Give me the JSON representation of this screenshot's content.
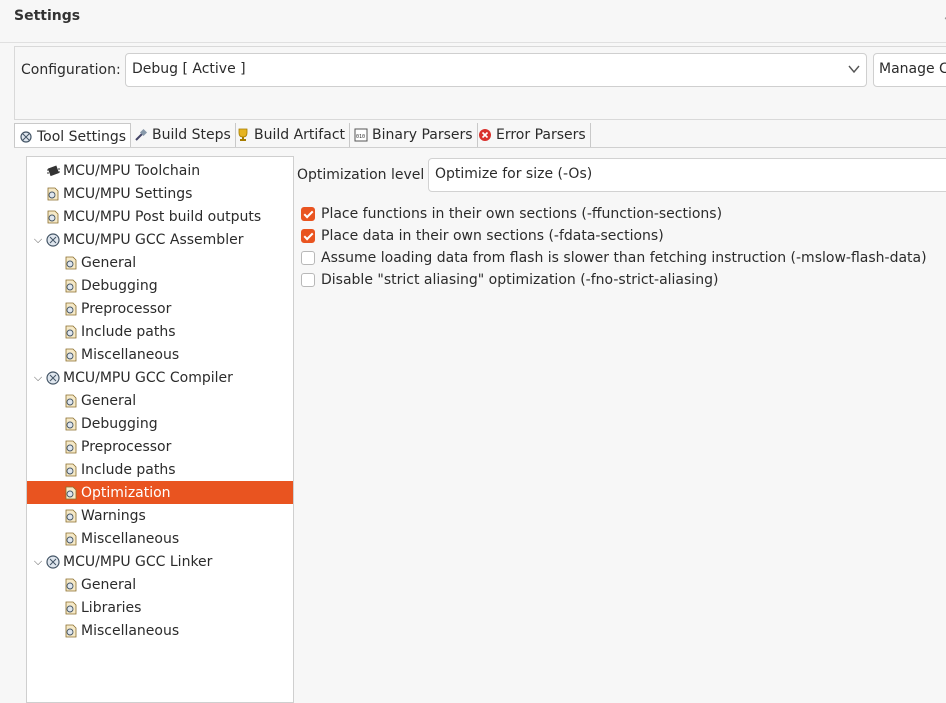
{
  "window": {
    "title": "Settings"
  },
  "config": {
    "label": "Configuration:",
    "value": "Debug  [ Active ]",
    "manage_label": "Manage Configurations..."
  },
  "tabs": [
    {
      "label": "Tool Settings",
      "icon": "tool-settings-icon",
      "active": true
    },
    {
      "label": "Build Steps",
      "icon": "build-steps-icon"
    },
    {
      "label": "Build Artifact",
      "icon": "trophy-icon"
    },
    {
      "label": "Binary Parsers",
      "icon": "binary-icon"
    },
    {
      "label": "Error Parsers",
      "icon": "error-icon"
    }
  ],
  "tree": [
    {
      "label": "MCU/MPU Toolchain",
      "level": 0
    },
    {
      "label": "MCU/MPU Settings",
      "level": 0
    },
    {
      "label": "MCU/MPU Post build outputs",
      "level": 0
    },
    {
      "label": "MCU/MPU GCC Assembler",
      "level": 0,
      "expanded": true
    },
    {
      "label": "General",
      "level": 1
    },
    {
      "label": "Debugging",
      "level": 1
    },
    {
      "label": "Preprocessor",
      "level": 1
    },
    {
      "label": "Include paths",
      "level": 1
    },
    {
      "label": "Miscellaneous",
      "level": 1
    },
    {
      "label": "MCU/MPU GCC Compiler",
      "level": 0,
      "expanded": true
    },
    {
      "label": "General",
      "level": 1
    },
    {
      "label": "Debugging",
      "level": 1
    },
    {
      "label": "Preprocessor",
      "level": 1
    },
    {
      "label": "Include paths",
      "level": 1
    },
    {
      "label": "Optimization",
      "level": 1,
      "selected": true
    },
    {
      "label": "Warnings",
      "level": 1
    },
    {
      "label": "Miscellaneous",
      "level": 1
    },
    {
      "label": "MCU/MPU GCC Linker",
      "level": 0,
      "expanded": true
    },
    {
      "label": "General",
      "level": 1
    },
    {
      "label": "Libraries",
      "level": 1
    },
    {
      "label": "Miscellaneous",
      "level": 1
    }
  ],
  "optimization": {
    "level_label": "Optimization level",
    "level_value": "Optimize for size (-Os)",
    "options": [
      {
        "label": "Place functions in their own sections (-ffunction-sections)",
        "checked": true
      },
      {
        "label": "Place data in their own sections (-fdata-sections)",
        "checked": true
      },
      {
        "label": "Assume loading data from flash is slower than fetching instruction (-mslow-flash-data)",
        "checked": false
      },
      {
        "label": "Disable \"strict aliasing\" optimization (-fno-strict-aliasing)",
        "checked": false
      }
    ]
  },
  "colors": {
    "accent": "#e95420"
  }
}
